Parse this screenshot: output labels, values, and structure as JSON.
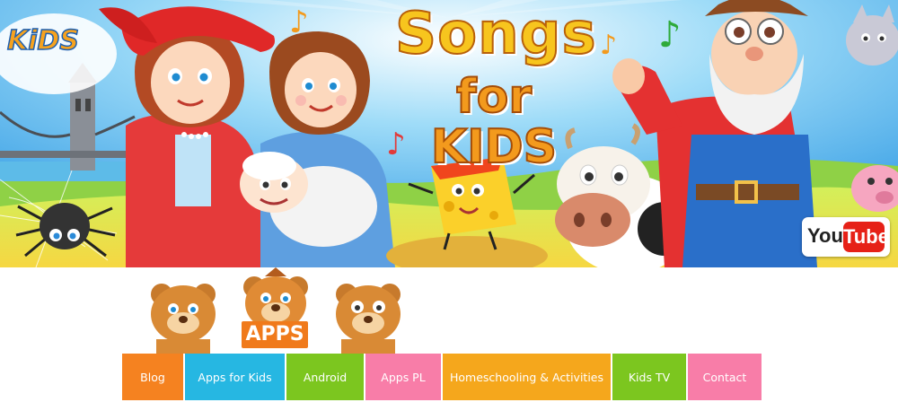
{
  "banner": {
    "title_line1": "Songs",
    "title_line2": "for KIDS",
    "logo_text": "KiDS",
    "youtube_you": "You",
    "youtube_tube": "Tube"
  },
  "apps": {
    "badge": "APPS"
  },
  "nav": {
    "items": [
      {
        "label": "Blog",
        "color": "#f58220"
      },
      {
        "label": "Apps for Kids",
        "color": "#26b7e2"
      },
      {
        "label": "Android",
        "color": "#7cc61f"
      },
      {
        "label": "Apps PL",
        "color": "#f87da8"
      },
      {
        "label": "Homeschooling & Activities",
        "color": "#f5a71c"
      },
      {
        "label": "Kids TV",
        "color": "#7cc61f"
      },
      {
        "label": "Contact",
        "color": "#f87da8"
      }
    ]
  }
}
